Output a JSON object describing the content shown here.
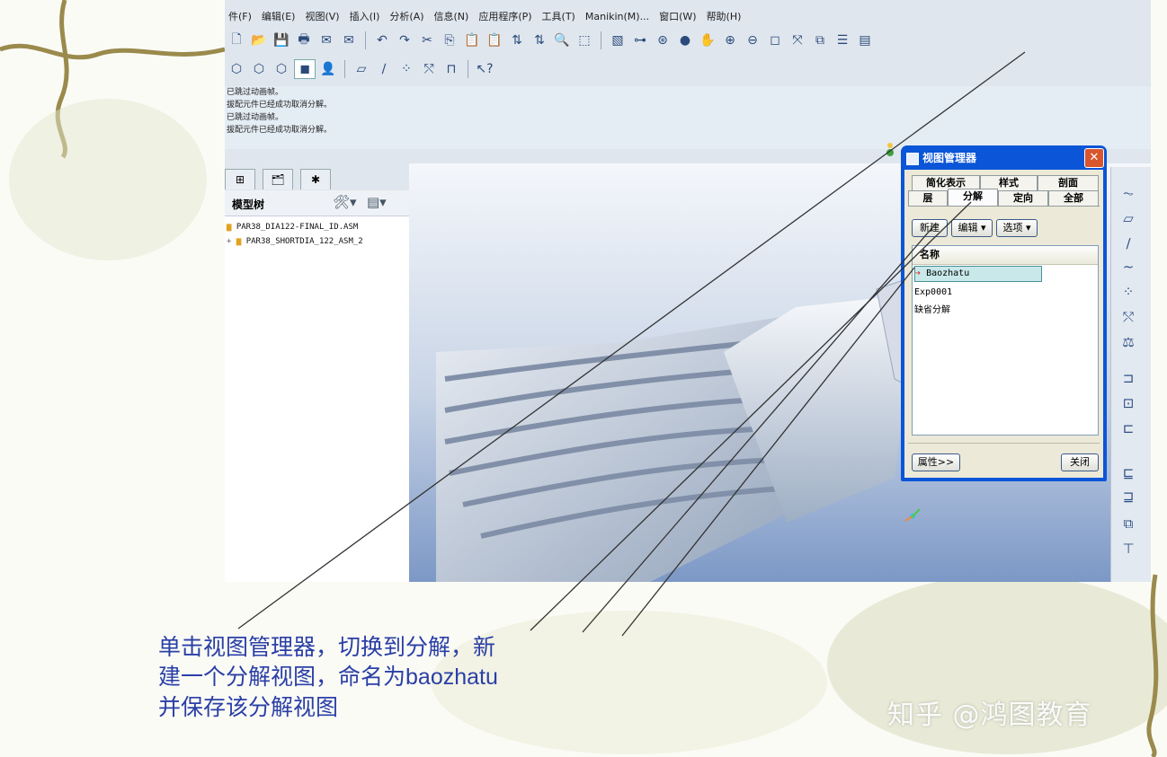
{
  "menu": [
    "件(F)",
    "编辑(E)",
    "视图(V)",
    "插入(I)",
    "分析(A)",
    "信息(N)",
    "应用程序(P)",
    "工具(T)",
    "Manikin(M)...",
    "窗口(W)",
    "帮助(H)"
  ],
  "messages": [
    "已跳过动画帧。",
    "拔配元件已经成功取消分解。",
    "已跳过动画帧。",
    "拔配元件已经成功取消分解。"
  ],
  "model_tree": {
    "title": "模型树",
    "items": [
      "PAR38_DIA122-FINAL_ID.ASM",
      "PAR38_SHORTDIA_122_ASM_2"
    ]
  },
  "view_manager": {
    "title": "视图管理器",
    "close_glyph": "✕",
    "tabs_row1": [
      "简化表示",
      "样式",
      "剖面"
    ],
    "tabs_row2": [
      "层",
      "分解",
      "定向",
      "全部"
    ],
    "active_tab": "分解",
    "buttons": {
      "new": "新建",
      "edit": "编辑 ▾",
      "options": "选项 ▾"
    },
    "list_header": "名称",
    "items": [
      "Baozhatu",
      "Exp0001",
      "缺省分解"
    ],
    "selected_item": "Baozhatu",
    "properties_button": "属性>>",
    "close_button": "关闭"
  },
  "caption": {
    "line1": "单击视图管理器，切换到分解，新",
    "line2_prefix": "建一个分解视图，命名为",
    "line2_name": "baozhatu",
    "line3": "并保存该分解视图"
  },
  "watermark": "知乎 @鸿图教育"
}
